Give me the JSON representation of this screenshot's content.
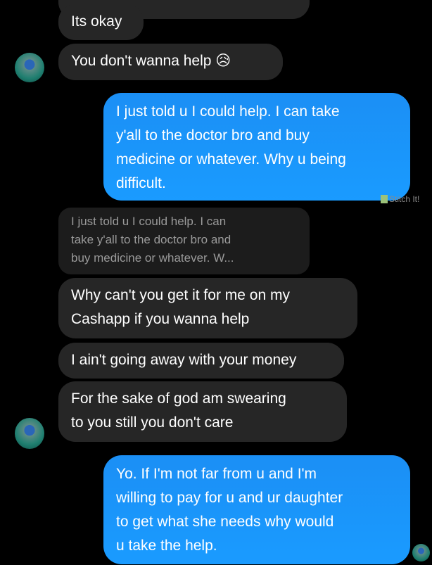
{
  "messages": [
    {
      "from": "them",
      "text": "Its okay"
    },
    {
      "from": "them",
      "text": "You don't wanna help",
      "emoji": "😥"
    },
    {
      "from": "me",
      "lines": [
        "I just told u I could help. I can take",
        "y'all to the doctor bro and buy",
        "medicine or whatever. Why u being",
        "difficult."
      ]
    },
    {
      "from": "them",
      "type": "reply-quote",
      "lines": [
        "I just told u I could help. I can",
        "take y'all to the doctor bro and",
        "buy medicine or whatever. W..."
      ]
    },
    {
      "from": "them",
      "lines": [
        "Why can't you get it for me on my",
        "Cashapp if you wanna help"
      ]
    },
    {
      "from": "them",
      "text": "I ain't going away with your money"
    },
    {
      "from": "them",
      "lines": [
        "For the sake of god am swearing",
        "to you still you don't care"
      ]
    },
    {
      "from": "me",
      "lines": [
        "Yo. If I'm not far from u and I'm",
        "willing to pay for u and ur daughter",
        "to get what she needs why would",
        "u take the help."
      ]
    }
  ],
  "watermark": "Stitch It!",
  "colors": {
    "sent": "#1a8cff",
    "received": "#262626",
    "quote": "#1c1c1c"
  }
}
